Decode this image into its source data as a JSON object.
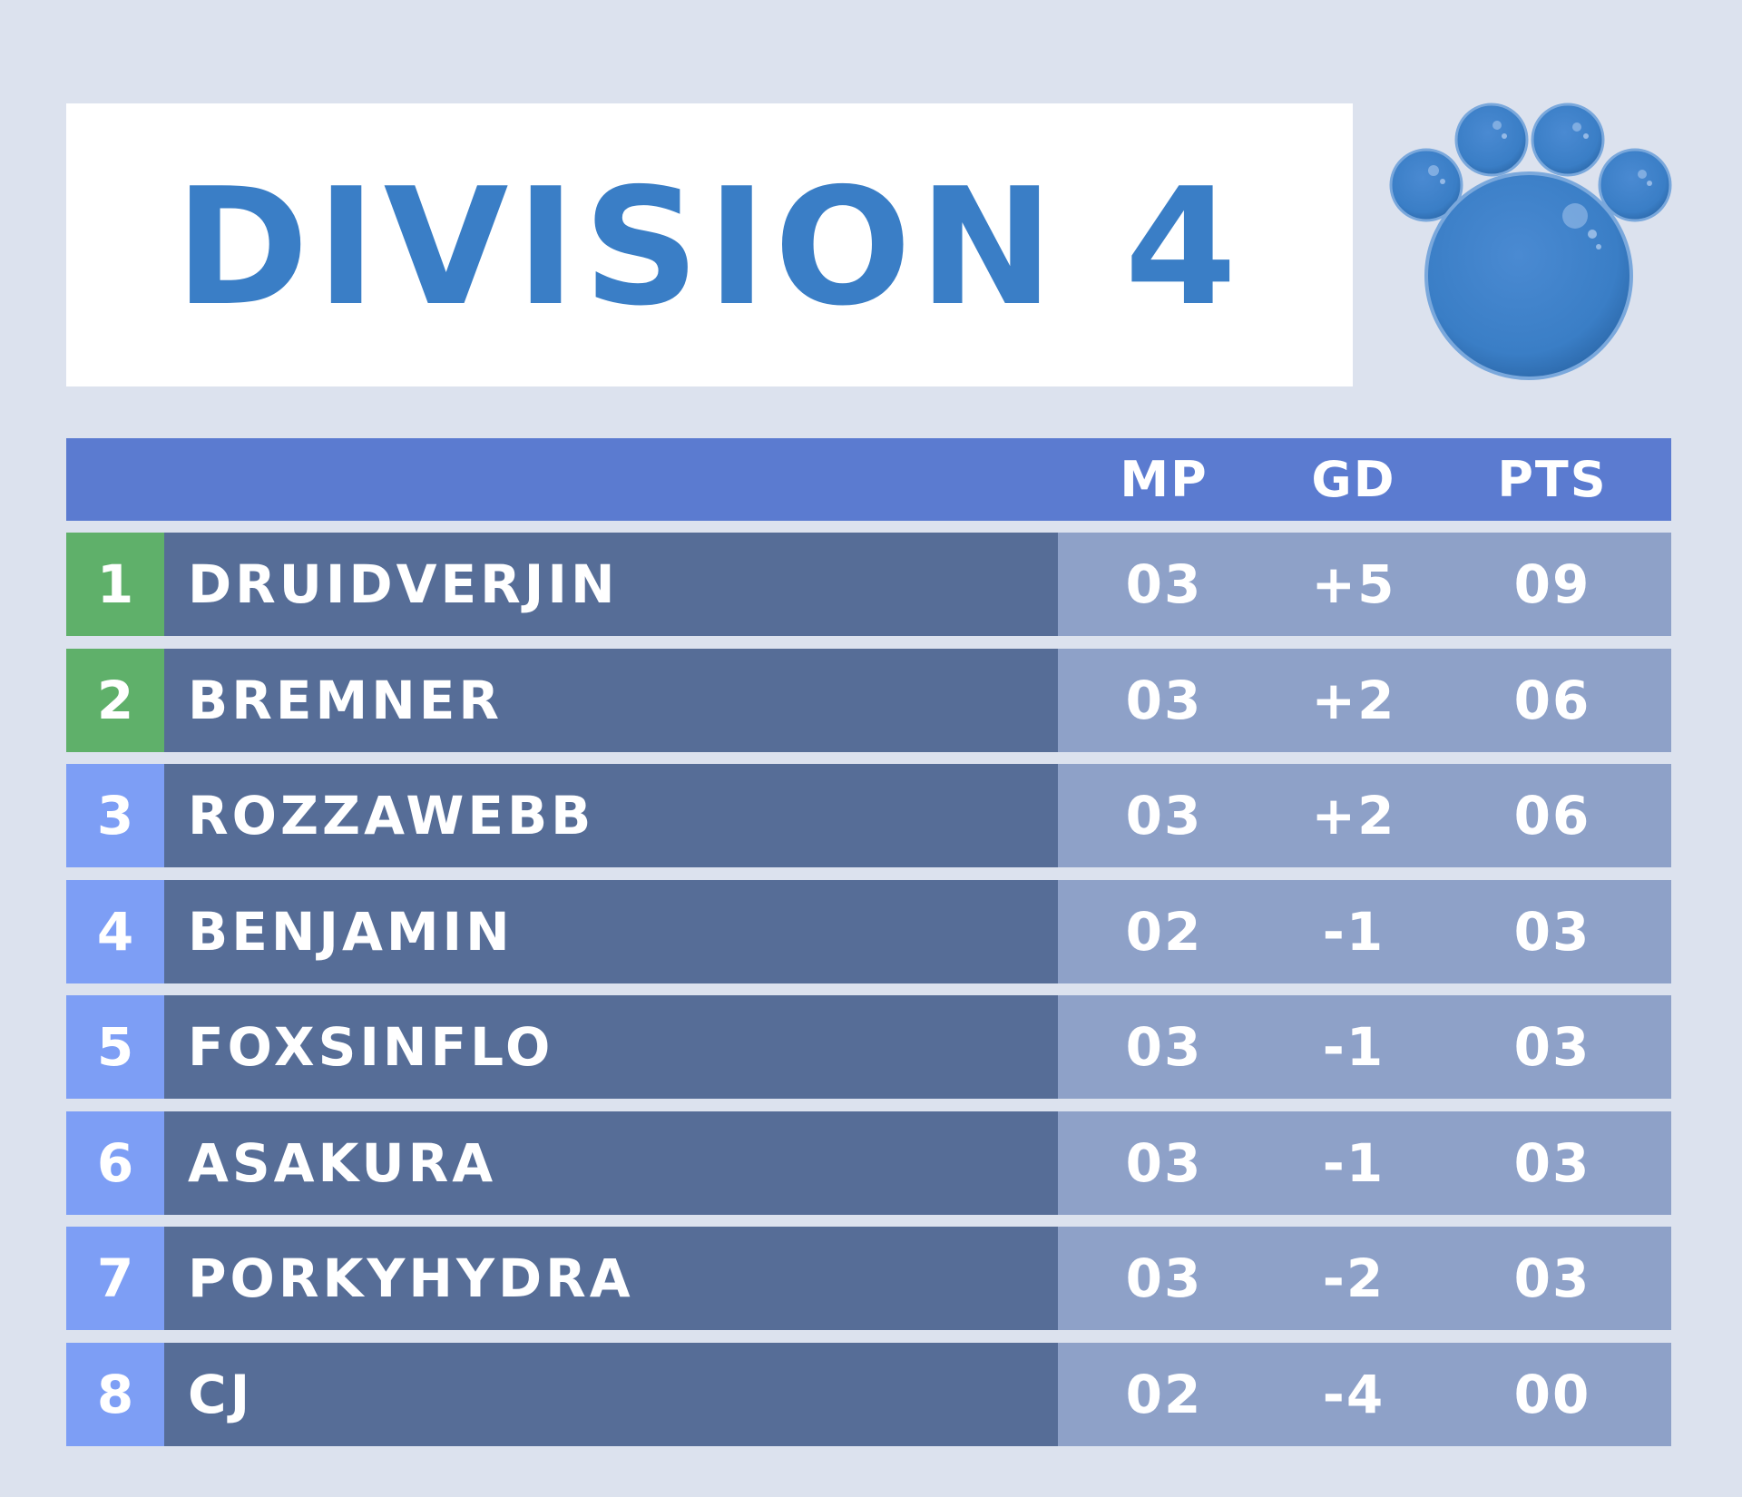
{
  "title": "DIVISION 4",
  "colors": {
    "background": "#dce2ee",
    "title_blue": "#3a7ec6",
    "header_bar": "#5b7bd0",
    "qualify_green": "#5fb06a",
    "rank_blue": "#7d9ef5",
    "name_bg": "#566d97",
    "stats_bg": "#8ea1c8"
  },
  "logo": {
    "icon": "paw-print-icon"
  },
  "table": {
    "columns": {
      "mp": "MP",
      "gd": "GD",
      "pts": "PTS"
    },
    "rows": [
      {
        "rank": "1",
        "name": "DRUIDVERJIN",
        "mp": "03",
        "gd": "+5",
        "pts": "09",
        "status": "qualified"
      },
      {
        "rank": "2",
        "name": "BREMNER",
        "mp": "03",
        "gd": "+2",
        "pts": "06",
        "status": "qualified"
      },
      {
        "rank": "3",
        "name": "ROZZAWEBB",
        "mp": "03",
        "gd": "+2",
        "pts": "06",
        "status": "normal"
      },
      {
        "rank": "4",
        "name": "BENJAMIN",
        "mp": "02",
        "gd": "-1",
        "pts": "03",
        "status": "normal"
      },
      {
        "rank": "5",
        "name": "FOXSINFLO",
        "mp": "03",
        "gd": "-1",
        "pts": "03",
        "status": "normal"
      },
      {
        "rank": "6",
        "name": "ASAKURA",
        "mp": "03",
        "gd": "-1",
        "pts": "03",
        "status": "normal"
      },
      {
        "rank": "7",
        "name": "PORKYHYDRA",
        "mp": "03",
        "gd": "-2",
        "pts": "03",
        "status": "normal"
      },
      {
        "rank": "8",
        "name": "CJ",
        "mp": "02",
        "gd": "-4",
        "pts": "00",
        "status": "normal"
      }
    ]
  }
}
